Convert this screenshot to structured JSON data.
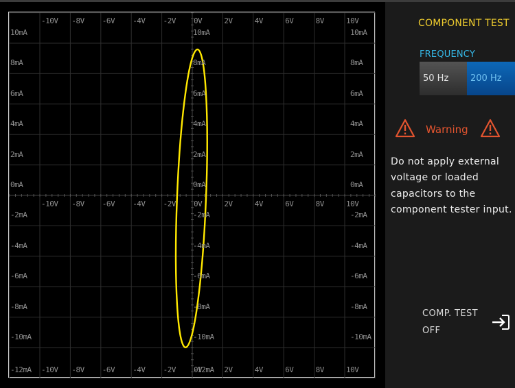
{
  "panel": {
    "title": "COMPONENT TEST",
    "frequency_label": "FREQUENCY",
    "frequency_options": [
      "50 Hz",
      "200 Hz"
    ],
    "selected_frequency": "200 Hz",
    "warning_title": "Warning",
    "warning_message": "Do not apply external voltage or loaded capacitors to the component tester input.",
    "comp_test_label_line1": "COMP. TEST",
    "comp_test_label_line2": "OFF"
  },
  "colors": {
    "trace": "#ffe800",
    "title": "#f0cd2e",
    "frequency": "#35b7e6",
    "warning": "#e3542f",
    "selected_button": "#0a5aa8"
  },
  "icons": [
    "warning-triangle-icon",
    "exit-arrow-icon"
  ],
  "chart_data": {
    "type": "line",
    "title": "",
    "x_unit": "V",
    "y_unit": "mA",
    "xlim": [
      -12,
      12
    ],
    "ylim": [
      -12,
      12
    ],
    "grid": true,
    "x_ticks": [
      "-10V",
      "-8V",
      "-6V",
      "-4V",
      "-2V",
      "0V",
      "2V",
      "4V",
      "6V",
      "8V",
      "10V"
    ],
    "y_ticks": [
      "10mA",
      "8mA",
      "6mA",
      "4mA",
      "2mA",
      "0mA",
      "-2mA",
      "-4mA",
      "-6mA",
      "-8mA",
      "-10mA",
      "-12mA"
    ],
    "series": [
      {
        "shape": "ellipse",
        "center_x": 0,
        "center_y": -0.2,
        "x_extent": [
          -1.0,
          0.9
        ],
        "y_extent": [
          -10.0,
          9.6
        ],
        "tilt": "slight, top toward +x"
      }
    ]
  }
}
